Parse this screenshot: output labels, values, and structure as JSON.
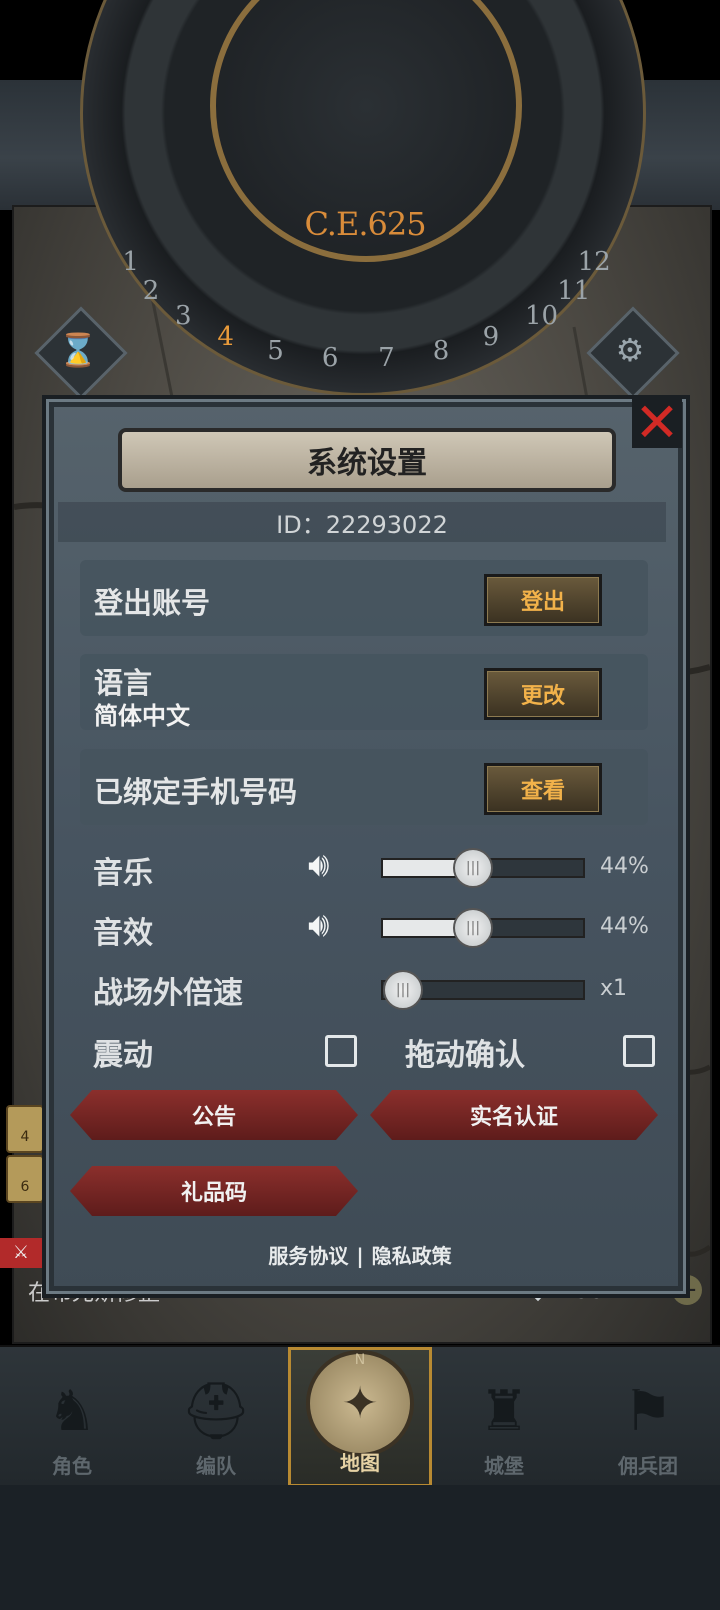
{
  "game": {
    "year": "C.E.625",
    "dial_numbers": [
      "1",
      "2",
      "3",
      "4",
      "5",
      "6",
      "7",
      "8",
      "9",
      "10",
      "11",
      "12"
    ],
    "active_month": "4",
    "behind_text": "在布兄斯修整",
    "behind_gem_count": "769",
    "side_badges": [
      "4",
      "6"
    ]
  },
  "dialog": {
    "title": "系统设置",
    "id_label": "ID：22293022",
    "rows": {
      "logout": {
        "label": "登出账号",
        "button": "登出"
      },
      "language": {
        "label": "语言",
        "value": "简体中文",
        "button": "更改"
      },
      "phone": {
        "label": "已绑定手机号码",
        "button": "查看"
      }
    },
    "music": {
      "label": "音乐",
      "value_text": "44%",
      "level": 0.44
    },
    "sfx": {
      "label": "音效",
      "value_text": "44%",
      "level": 0.44
    },
    "speed": {
      "label": "战场外倍速",
      "value_text": "x1",
      "level": 0.0
    },
    "vibration": {
      "label": "震动",
      "checked": false
    },
    "drag_confirm": {
      "label": "拖动确认",
      "checked": false
    },
    "buttons": {
      "notice": "公告",
      "real_name": "实名认证",
      "gift_code": "礼品码"
    },
    "footer": {
      "service": "服务协议",
      "separator": "|",
      "privacy": "隐私政策"
    },
    "close_icon": "close-x-icon"
  },
  "nav": {
    "items": [
      {
        "label": "角色",
        "icon": "knight-icon"
      },
      {
        "label": "编队",
        "icon": "helmet-icon"
      },
      {
        "label": "地图",
        "icon": "compass-icon"
      },
      {
        "label": "城堡",
        "icon": "castle-icon"
      },
      {
        "label": "佣兵团",
        "icon": "banner-icon"
      }
    ],
    "active_index": 2,
    "compass_letter": "N"
  }
}
